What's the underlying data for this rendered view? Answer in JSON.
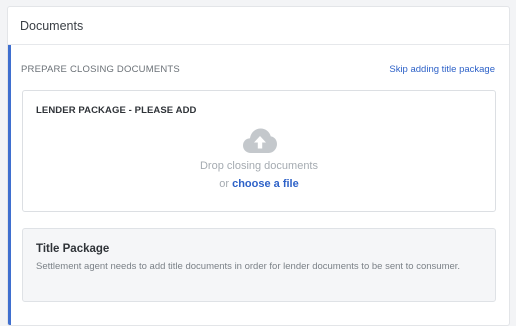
{
  "card": {
    "title": "Documents"
  },
  "section": {
    "title": "PREPARE CLOSING DOCUMENTS",
    "skip_link": "Skip adding title package"
  },
  "upload": {
    "title": "LENDER PACKAGE - PLEASE ADD",
    "icon": "cloud-upload-icon",
    "drop_text": "Drop closing documents",
    "or_text": "or",
    "choose_file": "choose a file"
  },
  "title_package": {
    "heading": "Title Package",
    "description": "Settlement agent needs to add title documents in order for lender documents to be sent to consumer."
  },
  "colors": {
    "accent": "#3f6fcf",
    "link": "#2e62c8",
    "muted_text": "#a5abb1",
    "icon": "#c4c8cc"
  }
}
